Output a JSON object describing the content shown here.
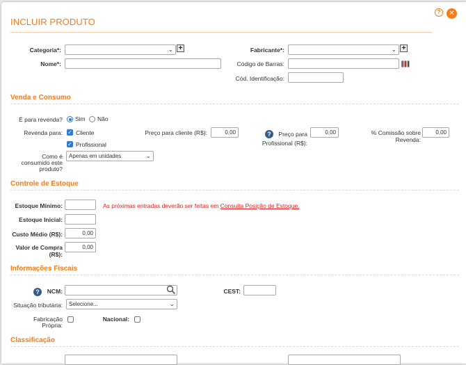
{
  "dialog": {
    "title": "INCLUIR PRODUTO",
    "help_label": "?",
    "close_label": "✕"
  },
  "product": {
    "categoria_label": "Categoria*:",
    "categoria_value": "",
    "fabricante_label": "Fabricante*:",
    "fabricante_value": "",
    "nome_label": "Nome*:",
    "nome_value": "",
    "codigo_barras_label": "Código de Barras:",
    "codigo_barras_value": "",
    "cod_identificacao_label": "Cód. Identificação:",
    "cod_identificacao_value": "",
    "add_label": "+"
  },
  "venda": {
    "section_title": "Venda e Consumo",
    "revenda_label": "É para revenda?",
    "sim_label": "Sim",
    "nao_label": "Não",
    "revenda_para_label": "Revenda para:",
    "cliente_label": "Cliente",
    "profissional_label": "Profissional",
    "preco_cliente_label": "Preço para cliente (R$):",
    "preco_cliente_value": "0,00",
    "preco_profissional_label_1": "Preço para",
    "preco_profissional_label_2": "Profissional (R$):",
    "preco_profissional_value": "0,00",
    "comissao_label_1": "% Comissão sobre",
    "comissao_label_2": "Revenda:",
    "comissao_value": "0,00",
    "consumo_label_1": "Como é",
    "consumo_label_2": "consumido este",
    "consumo_label_3": "produto?",
    "consumo_value": "Apenas em unidades"
  },
  "estoque": {
    "section_title": "Controle de Estoque",
    "minimo_label": "Estoque Mínimo:",
    "minimo_value": "",
    "warning_text": "As próximas entradas deverão ser feitas em ",
    "warning_link": "Consulta Posição de Estoque.",
    "inicial_label": "Estoque Inicial:",
    "inicial_value": "",
    "custo_label": "Custo Médio (R$):",
    "custo_value": "0,00",
    "compra_label_1": "Valor de Compra",
    "compra_label_2": "(R$):",
    "compra_value": "0,00"
  },
  "fiscal": {
    "section_title": "Informações Fiscais",
    "ncm_label": "NCM:",
    "ncm_value": "",
    "cest_label": "CEST:",
    "cest_value": "",
    "situacao_label": "Situação tributária:",
    "situacao_value": "Selecione...",
    "fabricacao_label_1": "Fabricação",
    "fabricacao_label_2": "Própria:",
    "nacional_label": "Nacional:"
  },
  "classificacao": {
    "section_title": "Classificação"
  },
  "icons": {
    "help": "help-circle-icon",
    "close": "close-icon",
    "add": "plus-square-icon",
    "barcode": "barcode-icon",
    "question": "question-icon",
    "search": "search-icon",
    "chevron": "chevron-down-icon"
  },
  "colors": {
    "accent": "#f27c1b",
    "info": "#345d8c",
    "warning": "#e02020",
    "checked": "#2e7ad1"
  }
}
